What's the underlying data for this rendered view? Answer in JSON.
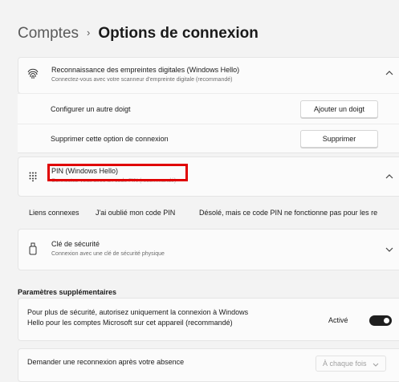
{
  "breadcrumb": {
    "parent": "Comptes",
    "separator": "›",
    "current": "Options de connexion"
  },
  "fingerprint": {
    "title": "Reconnaissance des empreintes digitales (Windows Hello)",
    "subtitle": "Connectez-vous avec votre scanneur d'empreinte digitale (recommandé)",
    "icon": "fingerprint-icon",
    "rows": [
      {
        "label": "Configurer un autre doigt",
        "button": "Ajouter un doigt"
      },
      {
        "label": "Supprimer cette option de connexion",
        "button": "Supprimer"
      }
    ]
  },
  "pin": {
    "title": "PIN (Windows Hello)",
    "subtitle": "Connectez-vous avec un code PIN (recommandé)",
    "icon": "pin-keypad-icon"
  },
  "related_links": {
    "label": "Liens connexes",
    "items": [
      "J'ai oublié mon code PIN",
      "Désolé, mais ce code PIN ne fonctionne pas pour les re"
    ]
  },
  "security_key": {
    "title": "Clé de sécurité",
    "subtitle": "Connexion avec une clé de sécurité physique",
    "icon": "usb-key-icon"
  },
  "additional": {
    "section_title": "Paramètres supplémentaires",
    "windows_hello_only": {
      "line1": "Pour plus de sécurité, autorisez uniquement la connexion à Windows",
      "line2": "Hello pour les comptes Microsoft sur cet appareil (recommandé)",
      "state_label": "Activé",
      "enabled": true
    },
    "reconnect": {
      "label": "Demander une reconnexion après votre absence",
      "value": "À chaque fois"
    }
  },
  "colors": {
    "highlight": "#e00000",
    "toggle_on": "#1f1f1f"
  }
}
